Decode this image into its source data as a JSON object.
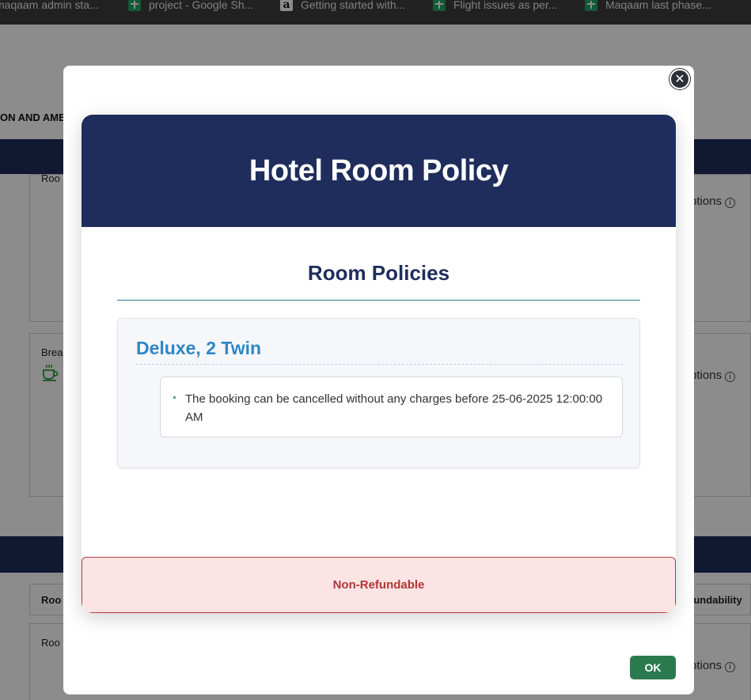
{
  "bookmarks": [
    {
      "label": "maqaam admin sta...",
      "icon": "none"
    },
    {
      "label": "project - Google Sh...",
      "icon": "sheets-icon"
    },
    {
      "label": "Getting started with...",
      "icon": "amazon-icon"
    },
    {
      "label": "Flight issues as per...",
      "icon": "sheets-icon"
    },
    {
      "label": "Maqaam last phase...",
      "icon": "sheets-icon"
    }
  ],
  "background": {
    "section_label": "ON AND AME",
    "row1_label": "Roo",
    "row2_label": "Brea",
    "row3_label": "Roo",
    "row4_label": "Roo",
    "options_text": "ptions",
    "options_text2": "ptions",
    "options_text3": "ptions",
    "refundability_header": "fundability",
    "info_glyph": "i"
  },
  "modal": {
    "close_glyph": "✕",
    "header_title": "Hotel Room Policy",
    "section_title": "Room Policies",
    "room": {
      "name": "Deluxe, 2 Twin",
      "policies": [
        "The booking can be cancelled without any charges before 25-06-2025 12:00:00 AM"
      ]
    },
    "refund_status": "Non-Refundable",
    "ok_label": "OK"
  },
  "colors": {
    "navy": "#1f2d5c",
    "room_name_blue": "#2f86c6",
    "refund_bg": "#fde4e4",
    "refund_text": "#b03636",
    "ok_green": "#2a7a4d"
  }
}
